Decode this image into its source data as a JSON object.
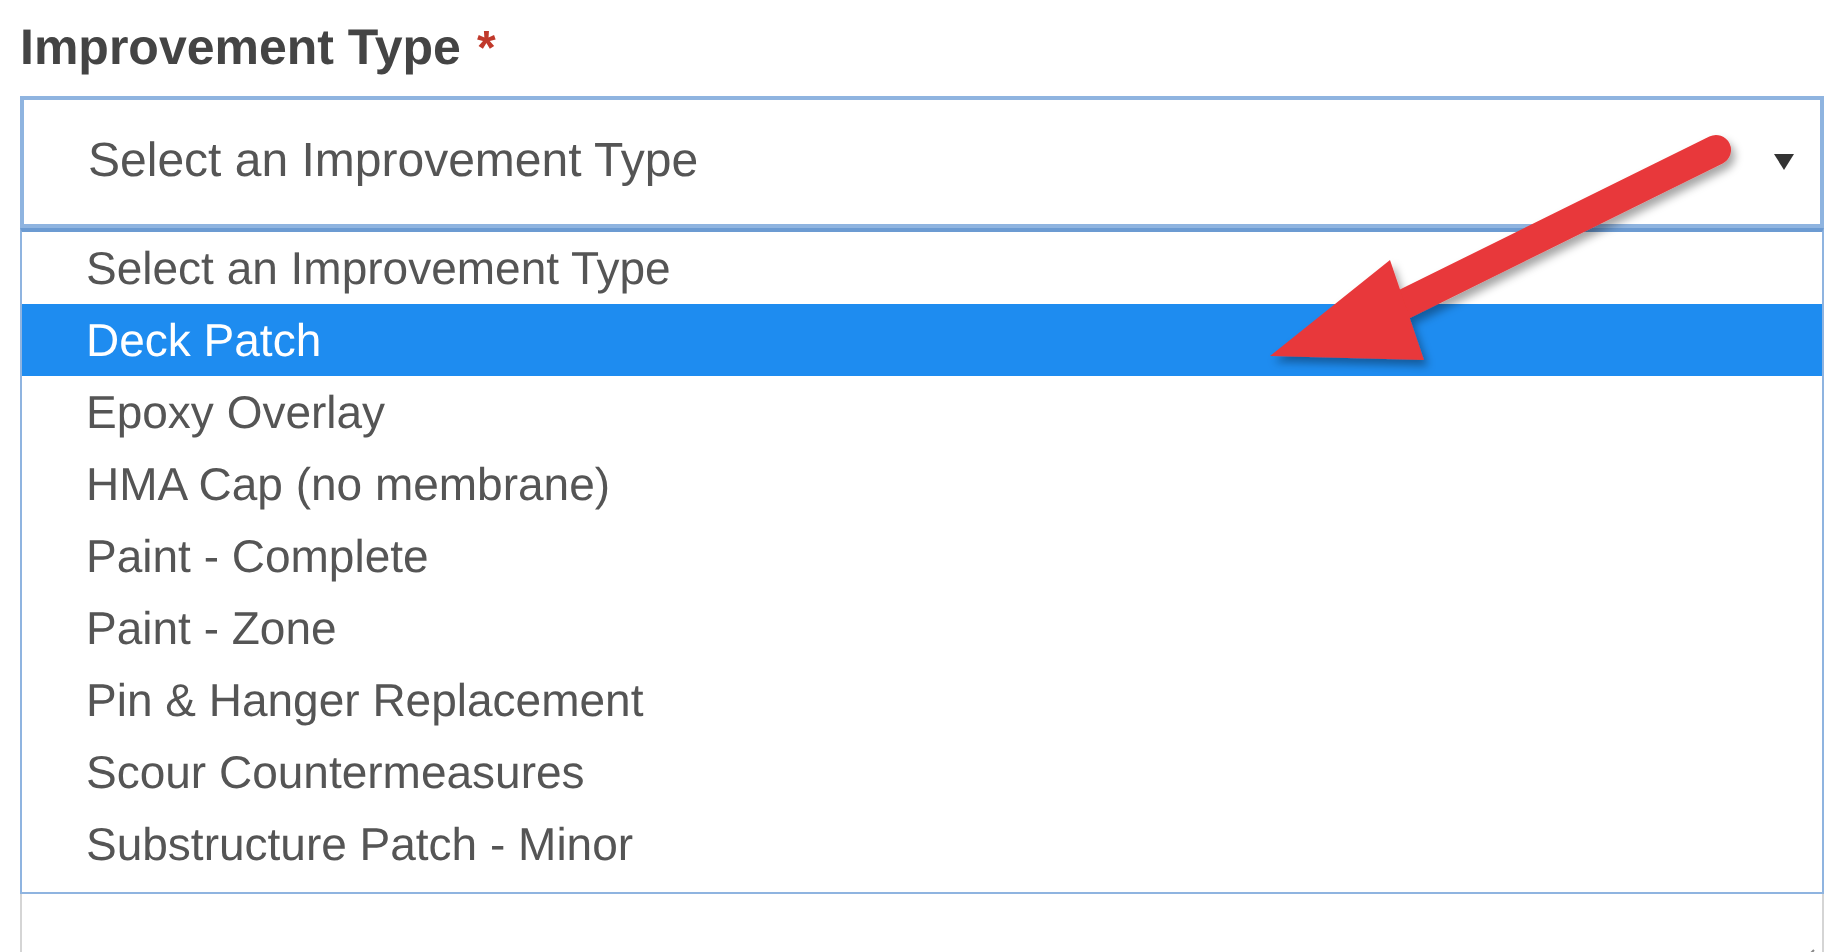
{
  "field": {
    "label": "Improvement Type",
    "required_mark": "*",
    "value": "Select an Improvement Type"
  },
  "options": [
    {
      "label": "Select an Improvement Type",
      "selected": false
    },
    {
      "label": "Deck Patch",
      "selected": true
    },
    {
      "label": "Epoxy Overlay",
      "selected": false
    },
    {
      "label": "HMA Cap (no membrane)",
      "selected": false
    },
    {
      "label": "Paint - Complete",
      "selected": false
    },
    {
      "label": "Paint - Zone",
      "selected": false
    },
    {
      "label": "Pin & Hanger Replacement",
      "selected": false
    },
    {
      "label": "Scour Countermeasures",
      "selected": false
    },
    {
      "label": "Substructure Patch - Minor",
      "selected": false
    }
  ]
}
